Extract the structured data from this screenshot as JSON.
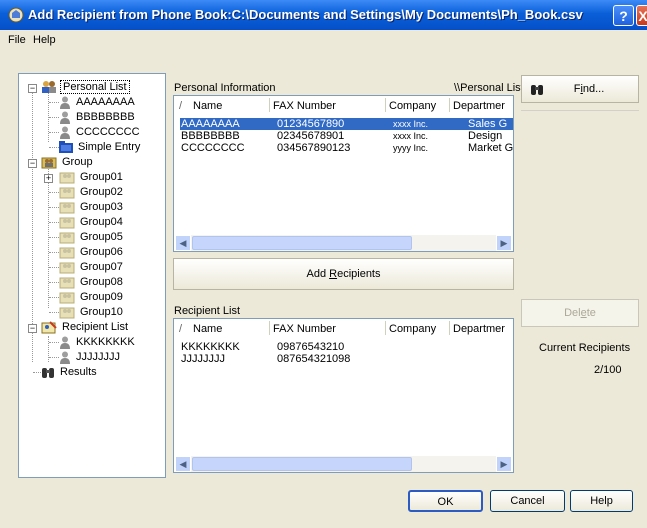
{
  "window": {
    "title": "Add Recipient from Phone Book:C:\\Documents and Settings\\My Documents\\Ph_Book.csv",
    "help_button": "?",
    "close_button": "X"
  },
  "menu": [
    "File",
    "Help"
  ],
  "tree": {
    "personal_list": "Personal List",
    "personal_items": [
      "AAAAAAAA",
      "BBBBBBBB",
      "CCCCCCCC"
    ],
    "simple_entry": "Simple Entry",
    "group": "Group",
    "groups": [
      "Group01",
      "Group02",
      "Group03",
      "Group04",
      "Group05",
      "Group06",
      "Group07",
      "Group08",
      "Group09",
      "Group10"
    ],
    "recipient_list": "Recipient List",
    "recipient_items": [
      "KKKKKKKK",
      "JJJJJJJJ"
    ],
    "results": "Results"
  },
  "personal_info": {
    "label": "Personal Information",
    "path": "\\\\Personal List",
    "columns": [
      "Name",
      "FAX Number",
      "Company",
      "Departmer"
    ],
    "rows": [
      {
        "name": "AAAAAAAA",
        "fax": "01234567890",
        "company": "xxxx Inc.",
        "dept": "Sales G"
      },
      {
        "name": "BBBBBBBB",
        "fax": "02345678901",
        "company": "xxxx Inc.",
        "dept": "Design"
      },
      {
        "name": "CCCCCCCC",
        "fax": "034567890123",
        "company": "yyyy Inc.",
        "dept": "Market G"
      }
    ]
  },
  "add_recipients_button": {
    "pre": "Add ",
    "key": "R",
    "post": "ecipients"
  },
  "recipient_list": {
    "label": "Recipient List",
    "columns": [
      "Name",
      "FAX Number",
      "Company",
      "Departmer"
    ],
    "rows": [
      {
        "name": "KKKKKKKK",
        "fax": "09876543210"
      },
      {
        "name": "JJJJJJJJ",
        "fax": "087654321098"
      }
    ]
  },
  "find_button": {
    "pre": "F",
    "key": "i",
    "post": "nd..."
  },
  "delete_button": {
    "pre": "Del",
    "key": "e",
    "post": "te"
  },
  "current_recipients": {
    "label": "Current Recipients",
    "value": "2/100"
  },
  "footer": {
    "ok": "OK",
    "cancel": "Cancel",
    "help": "Help"
  },
  "colors": {
    "titlebar": "#0a5fd8",
    "selection": "#316ac5",
    "dialog_bg": "#ece9d8"
  }
}
